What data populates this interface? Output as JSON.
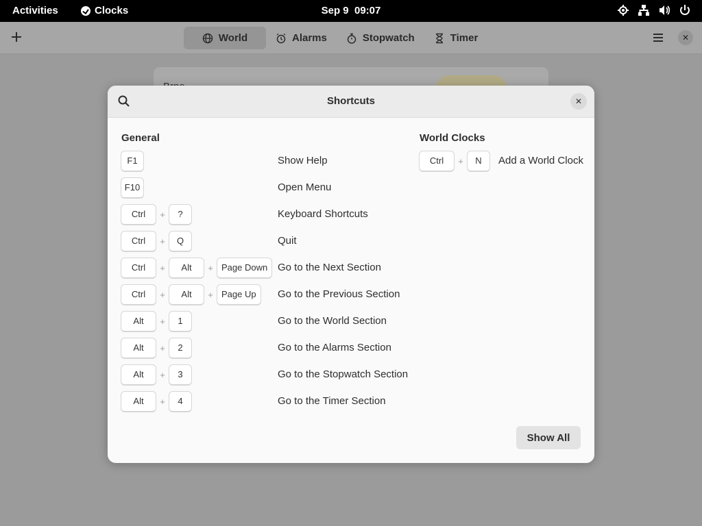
{
  "topbar": {
    "activities": "Activities",
    "app_name": "Clocks",
    "datetime_date": "Sep 9",
    "datetime_time": "09:07"
  },
  "appbar": {
    "tabs": [
      {
        "label": "World",
        "icon": "globe-icon"
      },
      {
        "label": "Alarms",
        "icon": "alarm-icon"
      },
      {
        "label": "Stopwatch",
        "icon": "stopwatch-icon"
      },
      {
        "label": "Timer",
        "icon": "hourglass-icon"
      }
    ],
    "active_tab": "World"
  },
  "background": {
    "city": "Brno"
  },
  "dialog": {
    "title": "Shortcuts",
    "show_all": "Show All",
    "general": {
      "title": "General",
      "shortcuts": [
        {
          "keys": [
            "F1"
          ],
          "description": "Show Help"
        },
        {
          "keys": [
            "F10"
          ],
          "description": "Open Menu"
        },
        {
          "keys": [
            "Ctrl",
            "?"
          ],
          "description": "Keyboard Shortcuts"
        },
        {
          "keys": [
            "Ctrl",
            "Q"
          ],
          "description": "Quit"
        },
        {
          "keys": [
            "Ctrl",
            "Alt",
            "Page Down"
          ],
          "description": "Go to the Next Section"
        },
        {
          "keys": [
            "Ctrl",
            "Alt",
            "Page Up"
          ],
          "description": "Go to the Previous Section"
        },
        {
          "keys": [
            "Alt",
            "1"
          ],
          "description": "Go to the World Section"
        },
        {
          "keys": [
            "Alt",
            "2"
          ],
          "description": "Go to the Alarms Section"
        },
        {
          "keys": [
            "Alt",
            "3"
          ],
          "description": "Go to the Stopwatch Section"
        },
        {
          "keys": [
            "Alt",
            "4"
          ],
          "description": "Go to the Timer Section"
        }
      ]
    },
    "world_clocks": {
      "title": "World Clocks",
      "shortcuts": [
        {
          "keys": [
            "Ctrl",
            "N"
          ],
          "description": "Add a World Clock"
        }
      ]
    },
    "plus_symbol": "+"
  }
}
